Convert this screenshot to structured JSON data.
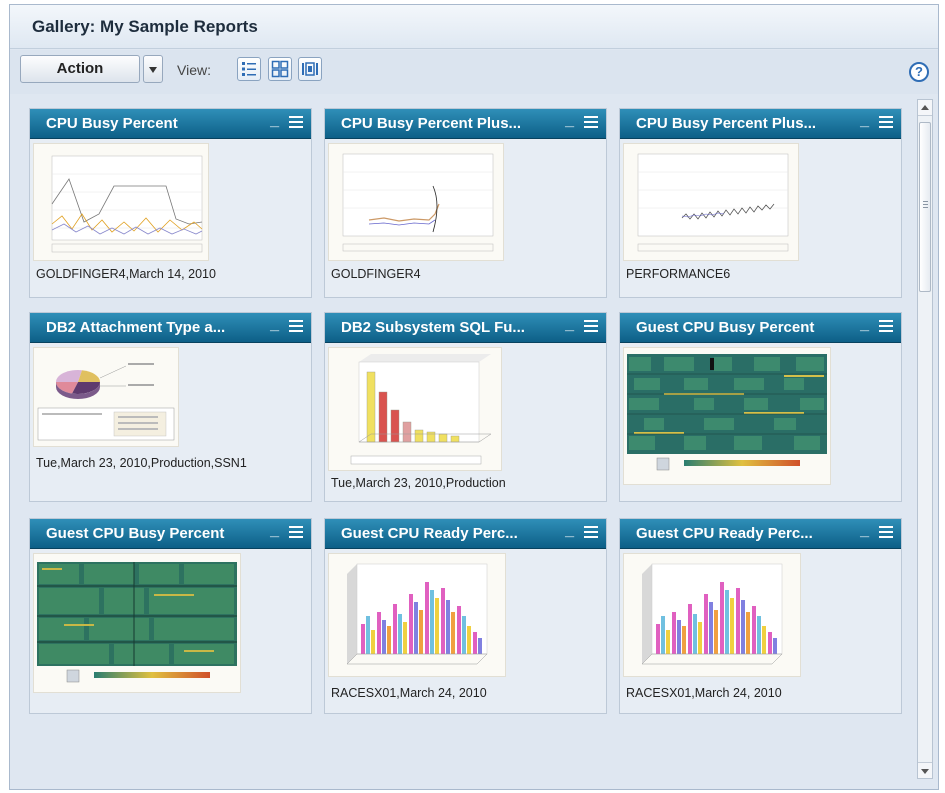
{
  "gallery": {
    "title": "Gallery: My Sample Reports"
  },
  "toolbar": {
    "action_label": "Action",
    "view_label": "View:",
    "view_modes": [
      "list-view-icon",
      "grid-view-icon",
      "filmstrip-view-icon"
    ],
    "help_icon": "help-icon"
  },
  "tiles": [
    {
      "title": "CPU Busy Percent",
      "caption": "GOLDFINGER4,March 14, 2010",
      "thumbnail": "line-chart"
    },
    {
      "title": "CPU Busy Percent Plus...",
      "caption": "GOLDFINGER4",
      "thumbnail": "line-chart"
    },
    {
      "title": "CPU Busy Percent Plus...",
      "caption": "PERFORMANCE6",
      "thumbnail": "line-chart"
    },
    {
      "title": "DB2 Attachment Type a...",
      "caption": "Tue,March 23, 2010,Production,SSN1",
      "thumbnail": "pie-chart"
    },
    {
      "title": "DB2 Subsystem SQL Fu...",
      "caption": "Tue,March 23, 2010,Production",
      "thumbnail": "3d-bar-chart"
    },
    {
      "title": "Guest CPU Busy Percent",
      "caption": "",
      "thumbnail": "treemap"
    },
    {
      "title": "Guest CPU Busy Percent",
      "caption": "",
      "thumbnail": "treemap"
    },
    {
      "title": "Guest CPU Ready Perc...",
      "caption": "RACESX01,March 24, 2010",
      "thumbnail": "3d-bar-chart"
    },
    {
      "title": "Guest CPU Ready Perc...",
      "caption": "RACESX01,March 24, 2010",
      "thumbnail": "3d-bar-chart"
    }
  ],
  "tile_controls": {
    "minimize_icon": "minimize-icon",
    "menu_icon": "menu-icon",
    "minimize_label": "_"
  },
  "help": {
    "label": "?"
  },
  "colors": {
    "tile_header": "#1a7aa3",
    "panel_bg": "#dfe7f1",
    "accent": "#2f6db5"
  }
}
